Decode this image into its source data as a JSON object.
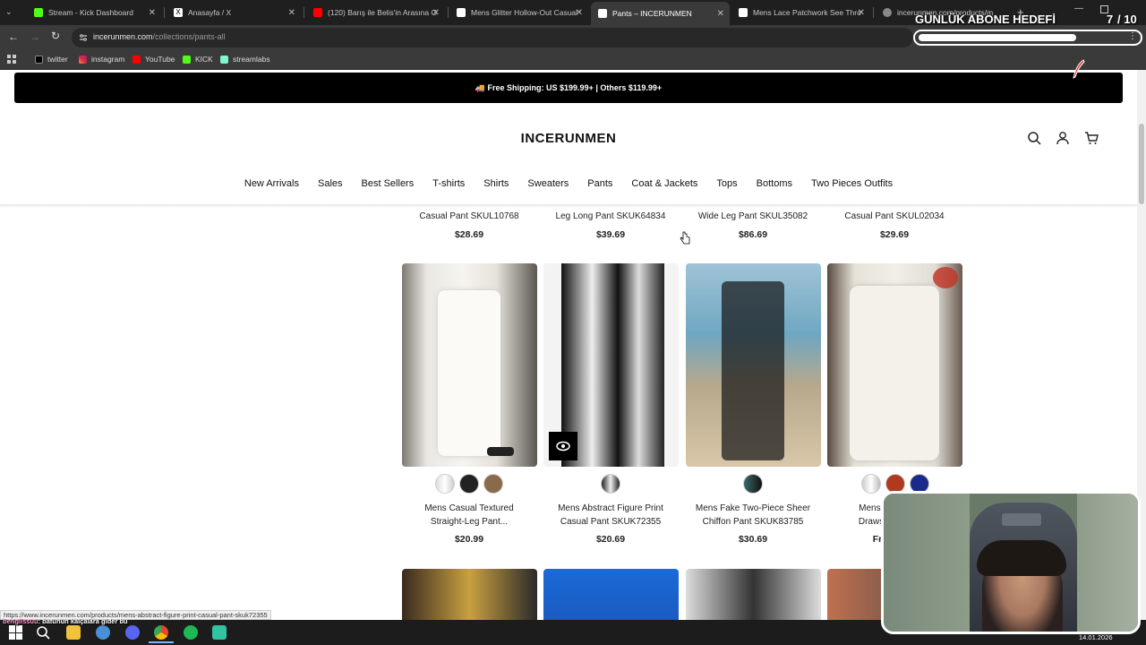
{
  "browser": {
    "tabs": [
      {
        "title": "Stream - Kick Dashboard",
        "color": "#53fc18"
      },
      {
        "title": "Anasayfa / X",
        "color": "#ffffff"
      },
      {
        "title": "(120) Barış ile Belis'in Arasına G",
        "color": "#ff0000"
      },
      {
        "title": "Mens Glitter Hollow-Out Casual",
        "color": "#ffffff"
      },
      {
        "title": "Pants – INCERUNMEN",
        "color": "#ffffff"
      },
      {
        "title": "Mens Lace Patchwork See Thro",
        "color": "#ffffff"
      },
      {
        "title": "incerunmen.com/products/m",
        "color": "#888888"
      }
    ],
    "url_domain": "incerunmen.com",
    "url_path": "/collections/pants-all",
    "bookmarks": [
      "twitter",
      "instagram",
      "YouTube",
      "KICK",
      "streamlabs"
    ]
  },
  "site": {
    "shipping_banner": "🚚 Free Shipping: US $199.99+ | Others $119.99+",
    "logo": "INCERUNMEN",
    "nav": [
      "New Arrivals",
      "Sales",
      "Best Sellers",
      "T-shirts",
      "Shirts",
      "Sweaters",
      "Pants",
      "Coat & Jackets",
      "Tops",
      "Bottoms",
      "Two Pieces Outfits"
    ],
    "row1": [
      {
        "title": "Casual Pant SKUL10768",
        "price": "$28.69"
      },
      {
        "title": "Leg Long Pant SKUK64834",
        "price": "$39.69"
      },
      {
        "title": "Wide Leg Pant SKUL35082",
        "price": "$86.69"
      },
      {
        "title": "Casual Pant SKUL02034",
        "price": "$29.69"
      }
    ],
    "row2": [
      {
        "title1": "Mens Casual Textured",
        "title2": "Straight-Leg Pant...",
        "price": "$20.99"
      },
      {
        "title1": "Mens Abstract Figure Print",
        "title2": "Casual Pant SKUK72355",
        "price": "$20.69"
      },
      {
        "title1": "Mens Fake Two-Piece Sheer",
        "title2": "Chiffon Pant SKUK83785",
        "price": "$30.69"
      },
      {
        "title1": "Mens Sol",
        "title2": "Drawstrin",
        "price": "Fr"
      }
    ]
  },
  "status_url": "https://www.incerunmen.com/products/mens-abstract-figure-print-casual-pant-skuk72355",
  "overlay": {
    "goal_label": "GÜNLÜK ABONE HEDEFİ",
    "goal_count": "7",
    "goal_total": "/ 10",
    "chat_user": "bengiissuu",
    "chat_msg": ": batunun kalçalara gider bu"
  },
  "taskbar": {
    "date": "14.01.2026"
  }
}
